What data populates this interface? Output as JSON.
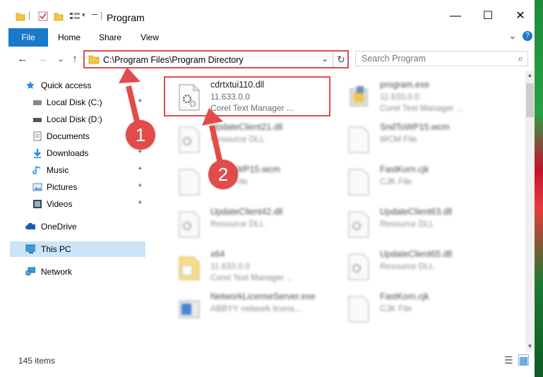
{
  "window": {
    "title": "Program",
    "controls": {
      "minimize": "—",
      "maximize": "☐",
      "close": "✕"
    }
  },
  "ribbon": {
    "tabs": [
      "File",
      "Home",
      "Share",
      "View"
    ],
    "expand_icon": "⌄",
    "help_icon": "?"
  },
  "navigation": {
    "back": "←",
    "forward": "→",
    "recent": "⌄",
    "up": "↑",
    "address": "C:\\Program Files\\Program Directory",
    "address_dropdown": "⌄",
    "refresh": "↻",
    "search_placeholder": "Search Program",
    "search_icon": "⌕"
  },
  "sidebar": {
    "items": [
      {
        "label": "Quick access",
        "icon": "star-icon",
        "pinned": false
      },
      {
        "label": "Local Disk (C:)",
        "icon": "drive-icon",
        "pinned": true
      },
      {
        "label": "Local Disk (D:)",
        "icon": "drive-icon",
        "pinned": false
      },
      {
        "label": "Documents",
        "icon": "documents-icon",
        "pinned": true
      },
      {
        "label": "Downloads",
        "icon": "download-icon",
        "pinned": true
      },
      {
        "label": "Music",
        "icon": "music-icon",
        "pinned": true
      },
      {
        "label": "Pictures",
        "icon": "pictures-icon",
        "pinned": true
      },
      {
        "label": "Videos",
        "icon": "videos-icon",
        "pinned": true
      },
      {
        "label": "OneDrive",
        "icon": "cloud-icon",
        "pinned": false
      },
      {
        "label": "This PC",
        "icon": "computer-icon",
        "pinned": false,
        "selected": true
      },
      {
        "label": "Network",
        "icon": "network-icon",
        "pinned": false
      }
    ],
    "pin_glyph": "📌"
  },
  "files": [
    {
      "name": "cdrtxtui110.dll",
      "line1": "11.633.0.0",
      "line2": "Corel Text Manager ...",
      "icon": "dll-gear-icon",
      "blurred": false
    },
    {
      "name": "program.exe",
      "line1": "11.633.0.0",
      "line2": "Corel Text Manager ...",
      "icon": "exe-icon",
      "blurred": true
    },
    {
      "name": "UpdateClient21.dll",
      "line1": "Resource DLL",
      "line2": "",
      "icon": "dll-gear-icon",
      "blurred": true
    },
    {
      "name": "SndToWP15.wcm",
      "line1": "WCM File",
      "line2": "",
      "icon": "blank-file-icon",
      "blurred": true
    },
    {
      "name": "SndToWP15.wcm",
      "line1": "WCM File",
      "line2": "",
      "icon": "blank-file-icon",
      "blurred": true
    },
    {
      "name": "FastKorn.cjk",
      "line1": "CJK File",
      "line2": "",
      "icon": "blank-file-icon",
      "blurred": true
    },
    {
      "name": "UpdateClient42.dll",
      "line1": "Resource DLL",
      "line2": "",
      "icon": "dll-gear-icon",
      "blurred": true
    },
    {
      "name": "UpdateClient63.dll",
      "line1": "Resource DLL",
      "line2": "",
      "icon": "dll-gear-icon",
      "blurred": true
    },
    {
      "name": "x64",
      "line1": "11.633.0.0",
      "line2": "Corel Text Manager ...",
      "icon": "folder-file-icon",
      "blurred": true
    },
    {
      "name": "UpdateClient65.dll",
      "line1": "Resource DLL",
      "line2": "",
      "icon": "dll-gear-icon",
      "blurred": true
    },
    {
      "name": "NetworkLicenseServer.exe",
      "line1": "ABBYY network licens...",
      "line2": "",
      "icon": "exe-window-icon",
      "blurred": true
    },
    {
      "name": "FastKorn.cjk",
      "line1": "CJK File",
      "line2": "",
      "icon": "blank-file-icon",
      "blurred": true
    }
  ],
  "status": {
    "item_count": "145 items",
    "details_view_icon": "☰",
    "large_icons_view_icon": "▦"
  },
  "annotations": {
    "step1": "1",
    "step2": "2",
    "highlight_color": "#e24b4b"
  },
  "colors": {
    "accent": "#1979ca",
    "selection": "#cce4f7",
    "annotation": "#e24b4b"
  }
}
